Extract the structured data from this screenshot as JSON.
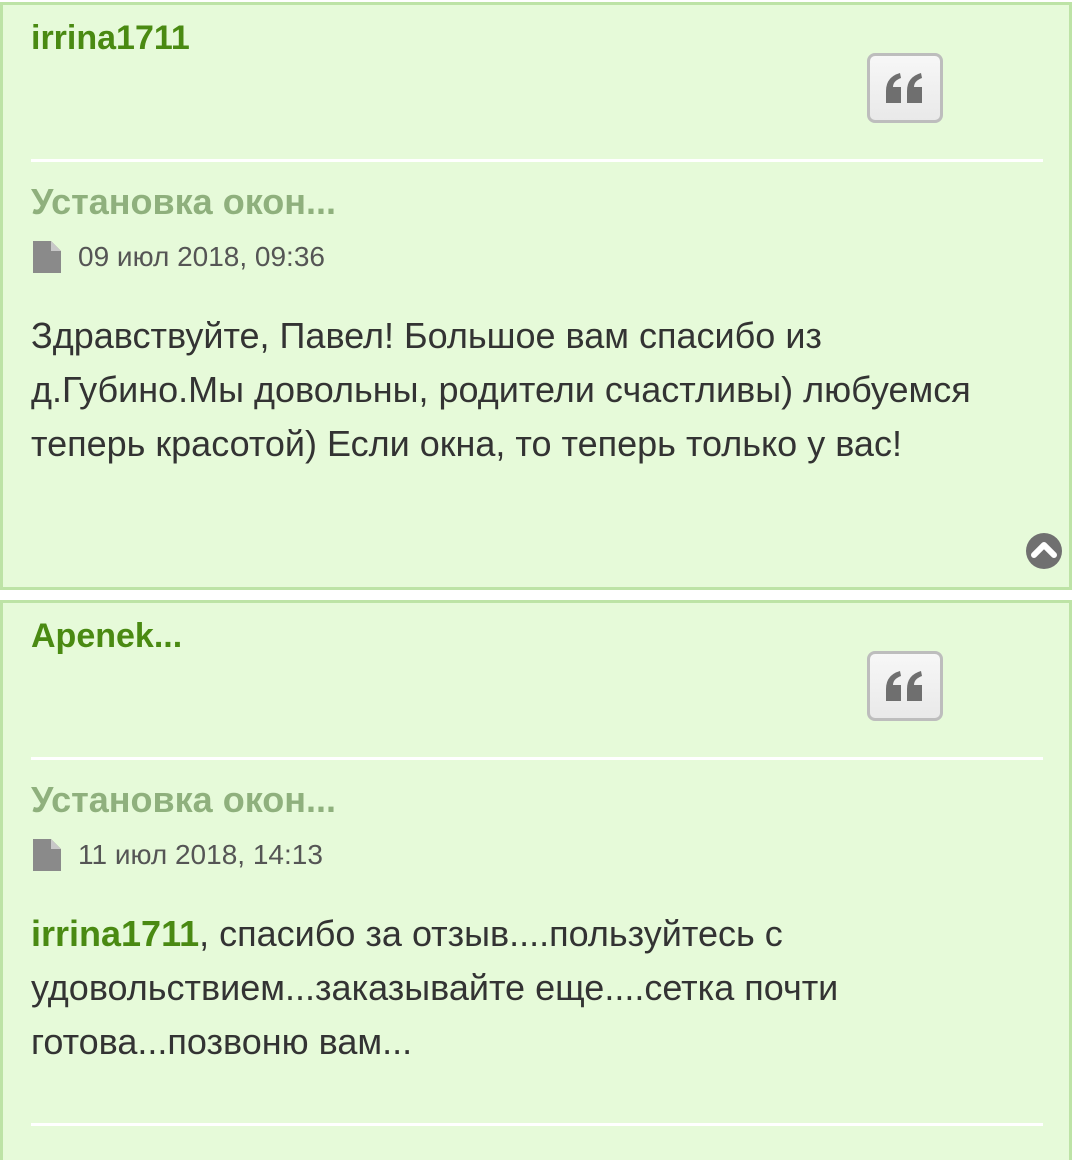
{
  "posts": [
    {
      "author": "irrina1711",
      "topic": "Установка окон...",
      "date": "09 июл 2018, 09:36",
      "text": "Здравствуйте, Павел! Большое вам спасибо из д.Губино.Мы довольны, родители счастливы) любуемся теперь красотой) Если окна, то теперь только у вас!"
    },
    {
      "author": "Apenek...",
      "topic": "Установка окон...",
      "date": "11 июл 2018, 14:13",
      "mention": "irrina1711",
      "text": ", спасибо за отзыв....пользуйтесь с удовольствием...заказывайте еще....сетка почти готова...позвоню вам..."
    }
  ],
  "icons": {
    "quote": "quote-icon",
    "post_file": "file-icon",
    "back_to_top": "chevron-up-circle-icon"
  },
  "colors": {
    "post_background": "#e6fad9",
    "post_border": "#bde3a6",
    "author": "#4a8a12",
    "topic": "#8fb07d",
    "text": "#333333"
  }
}
